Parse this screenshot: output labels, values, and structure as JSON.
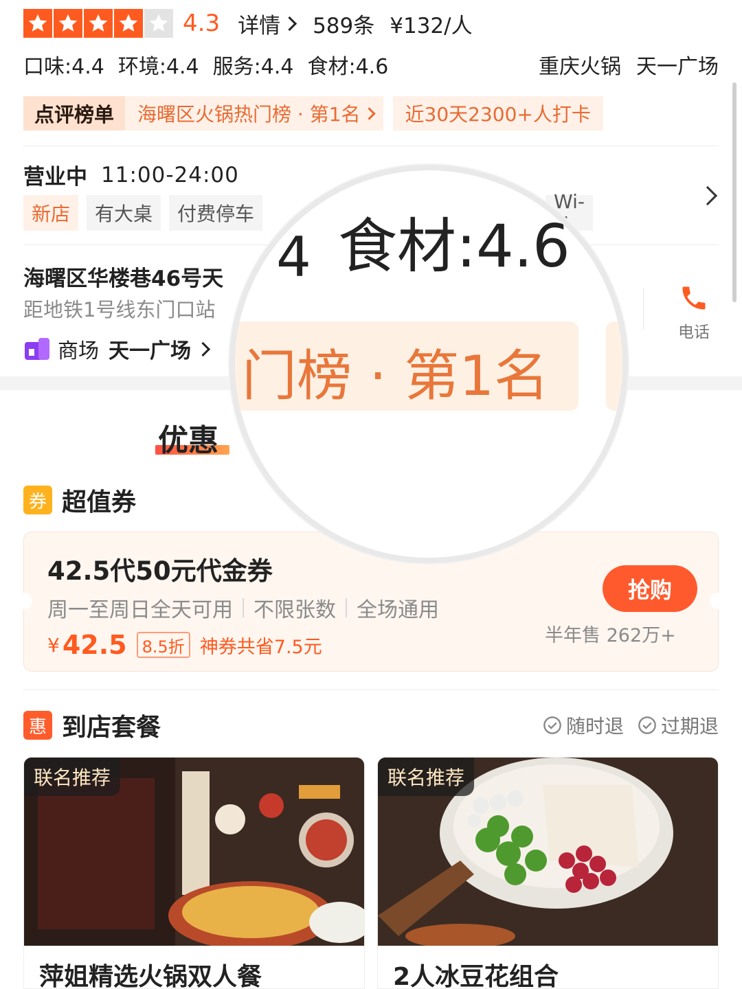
{
  "rating": {
    "score": "4.3",
    "stars_filled": 4,
    "stars_total": 5,
    "detail_label": "详情",
    "review_count": "589条",
    "avg_price": "¥132/人"
  },
  "scores": [
    "口味:4.4",
    "环境:4.4",
    "服务:4.4",
    "食材:4.6"
  ],
  "category_tags": [
    "重庆火锅",
    "天一广场"
  ],
  "ranking": {
    "badge": "点评榜单",
    "text": "海曙区火锅热门榜 · 第1名",
    "checkin": "近30天2300+人打卡"
  },
  "hours": {
    "status": "营业中",
    "time": "11:00-24:00"
  },
  "facilities": [
    "新店",
    "有大桌",
    "付费停车",
    "Wi-Fi"
  ],
  "address": {
    "street": "海曙区华楼巷46号天",
    "metro": "距地铁1号线东门口站",
    "mall_label": "商场",
    "mall_name": "天一广场",
    "phone_label": "电话"
  },
  "zoom": {
    "score_text": "食材:4.6",
    "prefix_text": "4",
    "rank_text": "门榜 · 第1名"
  },
  "tabs": {
    "active": "优惠"
  },
  "coupon_section": {
    "icon": "券",
    "title": "超值券",
    "card": {
      "title": "42.5代50元代金券",
      "desc": [
        "周一至周日全天可用",
        "不限张数",
        "全场通用"
      ],
      "yen": "¥",
      "price": "42.5",
      "discount": "8.5折",
      "saving": "神券共省7.5元",
      "buy_label": "抢购",
      "sales": "半年售 262万+"
    }
  },
  "package_section": {
    "icon": "惠",
    "title": "到店套餐",
    "refund": [
      "随时退",
      "过期退"
    ],
    "items": [
      {
        "badge": "联名推荐",
        "name": "萍姐精选火锅双人餐"
      },
      {
        "badge": "联名推荐",
        "name": "2人冰豆花组合"
      }
    ]
  },
  "colors": {
    "accent": "#ff5a1f",
    "rank_bg": "#fff1e8",
    "button": "#ff5a2d"
  }
}
